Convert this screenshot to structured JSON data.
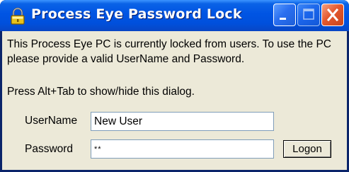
{
  "window": {
    "title": "Process Eye Password Lock",
    "icon": "padlock-icon"
  },
  "titlebar_buttons": {
    "minimize": "minimize-icon",
    "maximize": "maximize-icon",
    "close": "close-icon"
  },
  "message": "This Process Eye PC is currently locked from users. To use the PC please provide a valid UserName and Password.",
  "hint": "Press Alt+Tab to show/hide this dialog.",
  "form": {
    "username_label": "UserName",
    "username_value": "New User",
    "password_label": "Password",
    "password_value": "**",
    "logon_label": "Logon"
  },
  "colors": {
    "titlebar_blue": "#0054e3",
    "close_red": "#e4582e",
    "dialog_face": "#ece9d8"
  }
}
